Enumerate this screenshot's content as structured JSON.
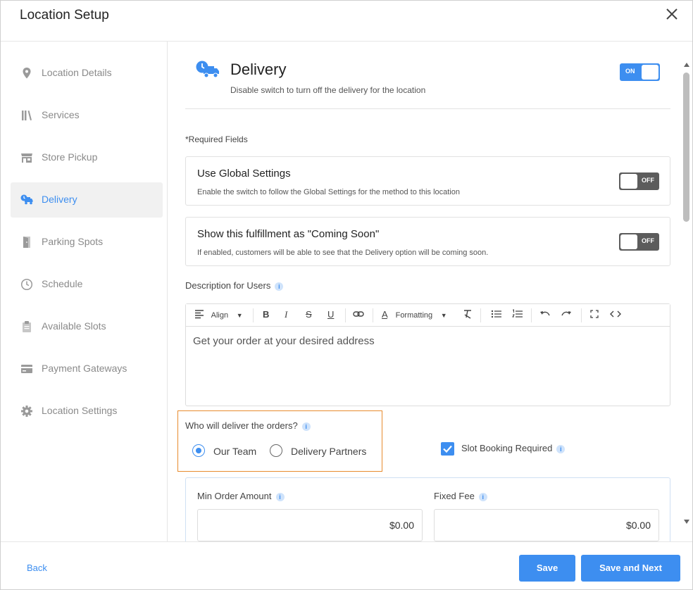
{
  "header": {
    "title": "Location Setup",
    "close_icon": "close-icon"
  },
  "sidebar": {
    "items": [
      {
        "label": "Location Details",
        "icon": "map-pin-icon",
        "active": false
      },
      {
        "label": "Services",
        "icon": "books-icon",
        "active": false
      },
      {
        "label": "Store Pickup",
        "icon": "storefront-icon",
        "active": false
      },
      {
        "label": "Delivery",
        "icon": "delivery-truck-icon",
        "active": true
      },
      {
        "label": "Parking Spots",
        "icon": "door-icon",
        "active": false
      },
      {
        "label": "Schedule",
        "icon": "clock-icon",
        "active": false
      },
      {
        "label": "Available Slots",
        "icon": "clipboard-icon",
        "active": false
      },
      {
        "label": "Payment Gateways",
        "icon": "card-icon",
        "active": false
      },
      {
        "label": "Location Settings",
        "icon": "gear-icon",
        "active": false
      }
    ]
  },
  "section": {
    "title": "Delivery",
    "subtitle": "Disable switch to turn off the delivery for the location",
    "toggle_label": "ON",
    "required_note": "*Required Fields"
  },
  "global_settings": {
    "title": "Use Global Settings",
    "subtitle": "Enable the switch to follow the Global Settings for the method to this location",
    "toggle_label": "OFF"
  },
  "coming_soon": {
    "title": "Show this fulfillment as \"Coming Soon\"",
    "subtitle": "If enabled, customers will be able to see that the Delivery option will be coming soon.",
    "toggle_label": "OFF"
  },
  "description": {
    "label": "Description for Users",
    "info_glyph": "i",
    "toolbar": {
      "align_label": "Align",
      "formatting_label": "Formatting",
      "bold": "B",
      "italic": "I",
      "strike": "S",
      "underline": "U"
    },
    "text": "Get your order at your desired address"
  },
  "deliver": {
    "question": "Who will deliver the orders?",
    "options": [
      {
        "label": "Our Team",
        "selected": true
      },
      {
        "label": "Delivery Partners",
        "selected": false
      }
    ]
  },
  "slot_booking": {
    "label": "Slot Booking Required",
    "checked": true
  },
  "amounts": {
    "min_order_label": "Min Order Amount",
    "min_order_value": "$0.00",
    "fixed_fee_label": "Fixed Fee",
    "fixed_fee_value": "$0.00"
  },
  "footer": {
    "back_label": "Back",
    "save_label": "Save",
    "save_next_label": "Save and Next"
  },
  "colors": {
    "accent": "#3d8ef0",
    "highlight_border": "#e88b2e",
    "toggle_off": "#5c5c5c"
  }
}
